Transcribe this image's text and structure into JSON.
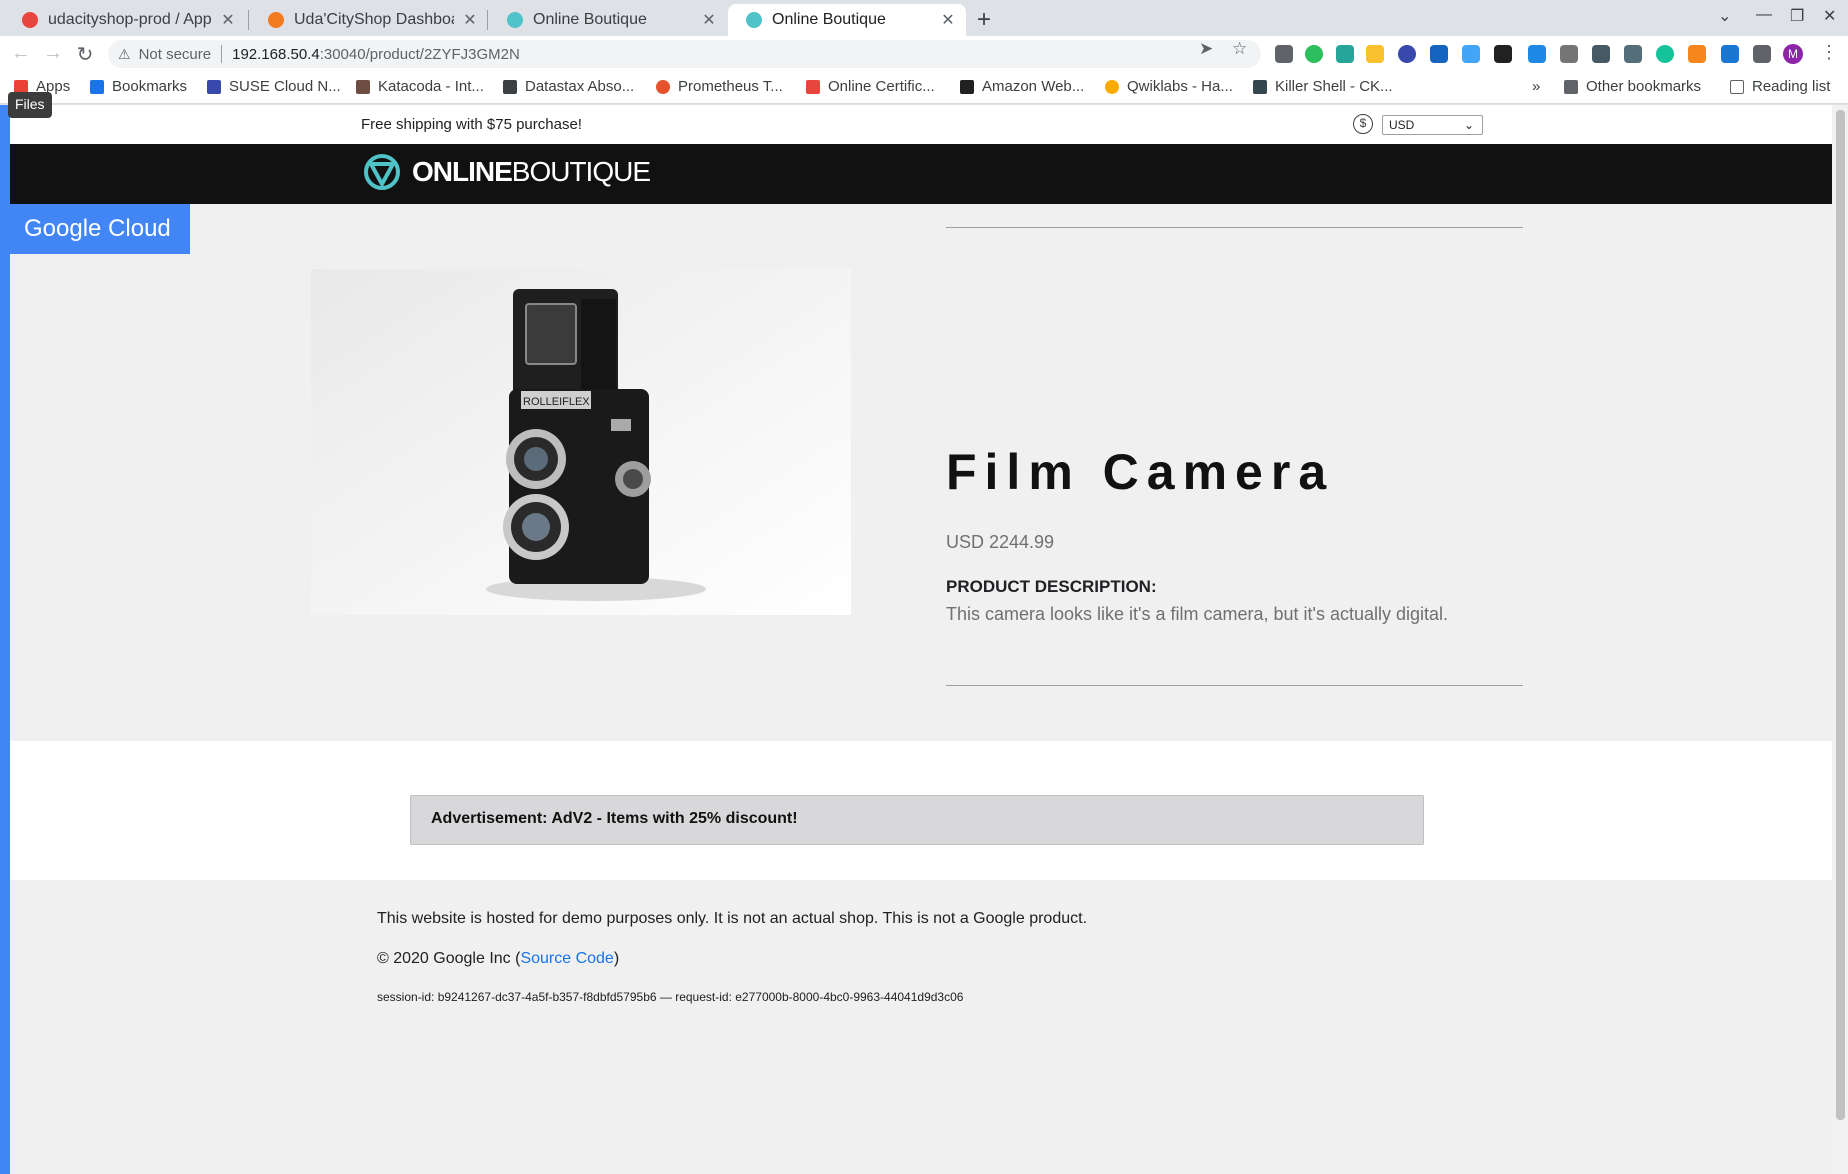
{
  "tabs": [
    {
      "label": "udacityshop-prod / Applic",
      "favicon_color": "#e8453c",
      "active": false
    },
    {
      "label": "Uda'CityShop Dashboard",
      "favicon_color": "#f47c20",
      "active": false
    },
    {
      "label": "Online Boutique",
      "favicon_color": "#4fc3c7",
      "active": false
    },
    {
      "label": "Online Boutique",
      "favicon_color": "#4fc3c7",
      "active": true
    }
  ],
  "tab_close": "✕",
  "new_tab": "+",
  "window_controls": {
    "dropdown": "⌄",
    "minimize": "—",
    "restore": "❐",
    "close": "✕"
  },
  "toolbar": {
    "back": "←",
    "forward": "→",
    "reload": "↻",
    "security_icon": "⚠",
    "security_text": "Not secure",
    "url_host": "192.168.50.4",
    "url_path": ":30040/product/2ZYFJ3GM2N",
    "send_icon": "➤",
    "star_icon": "☆",
    "profile_initial": "M",
    "menu_icon": "⋮"
  },
  "bookmarks": [
    {
      "label": "Apps",
      "color": "#ea4335"
    },
    {
      "label": "Bookmarks",
      "color": "#1a73e8"
    },
    {
      "label": "SUSE Cloud N...",
      "color": "#3949ab"
    },
    {
      "label": "Katacoda - Int...",
      "color": "#6d4c41"
    },
    {
      "label": "Datastax Abso...",
      "color": "#3c4043"
    },
    {
      "label": "Prometheus T...",
      "color": "#e6522c"
    },
    {
      "label": "Online Certific...",
      "color": "#e8453c"
    },
    {
      "label": "Amazon Web...",
      "color": "#212121"
    },
    {
      "label": "Qwiklabs - Ha...",
      "color": "#f9ab00"
    },
    {
      "label": "Killer Shell - CK...",
      "color": "#37474f"
    }
  ],
  "bookmarks_more": "»",
  "other_bookmarks": "Other bookmarks",
  "reading_list": "Reading list",
  "files_tooltip": "Files",
  "page": {
    "shipping": "Free shipping with $75 purchase!",
    "currency_symbol": "$",
    "currency": "USD",
    "brand_bold": "ONLINE",
    "brand_light": "BOUTIQUE",
    "google_cloud": "Google Cloud",
    "product": {
      "name": "Film Camera",
      "price": "USD 2244.99",
      "description_heading": "PRODUCT DESCRIPTION:",
      "description": "This camera looks like it's a film camera, but it's actually digital.",
      "camera_brand": "ROLLEIFLEX"
    },
    "ad": "Advertisement: AdV2 - Items with 25% discount!",
    "footer": {
      "notice": "This website is hosted for demo purposes only. It is not an actual shop. This is not a Google product.",
      "copyright_prefix": "© 2020 Google Inc (",
      "source_code": "Source Code",
      "copyright_suffix": ")",
      "session": "session-id: b9241267-dc37-4a5f-b357-f8dbfd5795b6 — request-id: e277000b-8000-4bc0-9963-44041d9d3c06"
    }
  },
  "colors": {
    "accent": "#4285f4",
    "brand_teal": "#4fc3c7",
    "navbar": "#111111"
  }
}
